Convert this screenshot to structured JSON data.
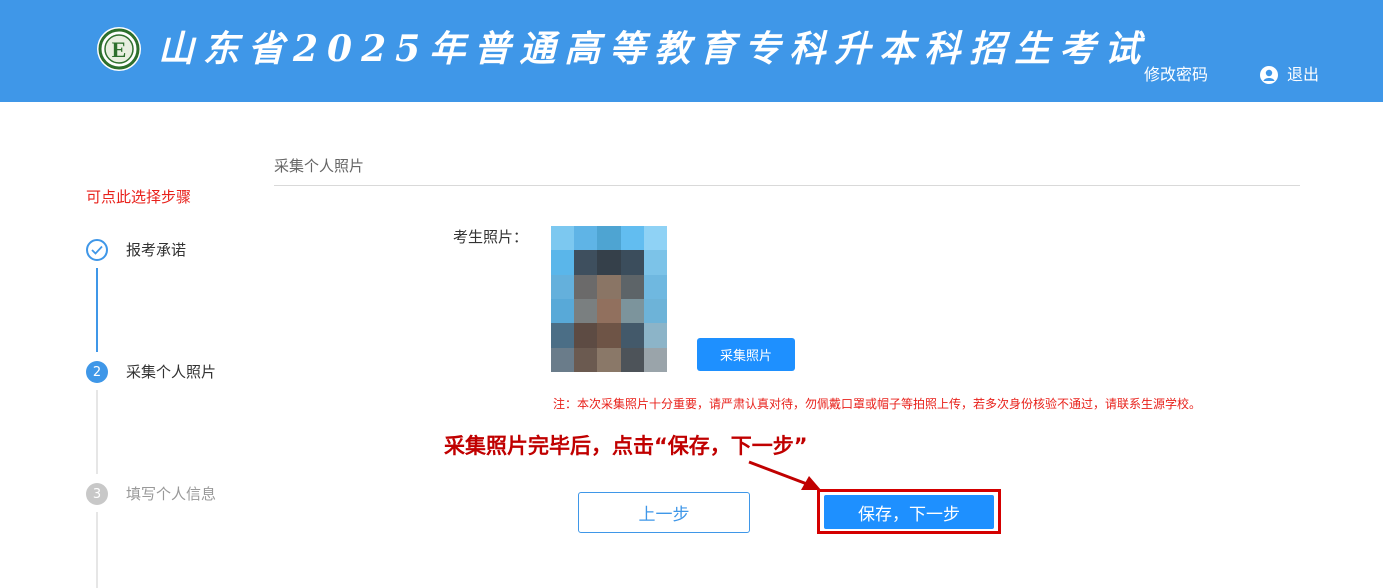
{
  "header": {
    "title": "山东省2025年普通高等教育专科升本科招生考试",
    "change_password": "修改密码",
    "logout": "退出",
    "logo_icon": "school-emblem-logo",
    "user_icon": "user-icon",
    "background_color": "#3f97e8"
  },
  "sidebar": {
    "hint": "可点此选择步骤",
    "steps": [
      {
        "number": "1",
        "label": "报考承诺",
        "status": "completed",
        "icon": "check-icon"
      },
      {
        "number": "2",
        "label": "采集个人照片",
        "status": "current"
      },
      {
        "number": "3",
        "label": "填写个人信息",
        "status": "pending"
      }
    ]
  },
  "main": {
    "section_title": "采集个人照片",
    "photo_label": "考生照片：",
    "photo_state": "pixelated-placeholder",
    "capture_button": "采集照片",
    "note": "注：本次采集照片十分重要，请严肃认真对待，勿佩戴口罩或帽子等拍照上传，若多次身份核验不通过，请联系生源学校。",
    "instruction": "采集照片完毕后，点击“保存，下一步”",
    "prev_button": "上一步",
    "save_next_button": "保存，下一步"
  },
  "colors": {
    "accent": "#3f97e8",
    "button": "#1e90ff",
    "warning_red": "#e8211b",
    "annotation_red": "#c00000",
    "pending_gray": "#c8c8c8"
  }
}
